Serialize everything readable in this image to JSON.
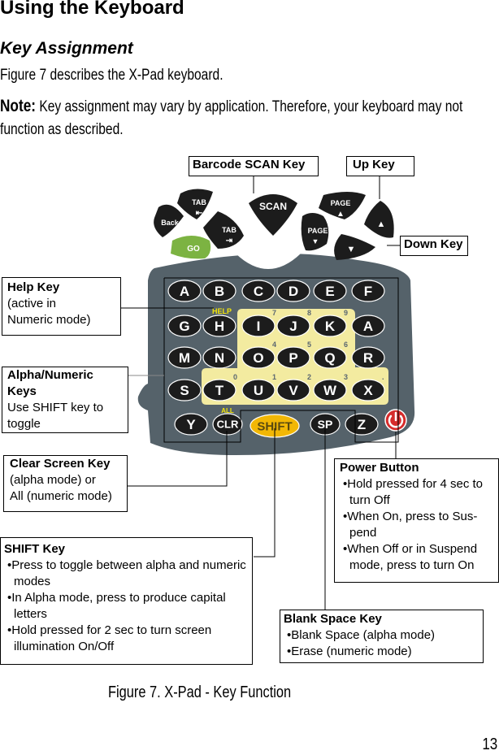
{
  "page": {
    "heading": "Using the Keyboard",
    "subheading": "Key Assignment",
    "intro": "Figure 7 describes the X-Pad keyboard.",
    "note_label": "Note:",
    "note_text": " Key assignment may vary by application. Therefore, your keyboard may not function as described.",
    "caption": "Figure 7.  X-Pad - Key Function",
    "page_number": "13"
  },
  "callouts": {
    "scan": {
      "title": "Barcode SCAN Key"
    },
    "up": {
      "title": "Up Key"
    },
    "down": {
      "title": "Down Key"
    },
    "help": {
      "title": "Help Key",
      "lines": [
        "(active in",
        "Numeric mode)"
      ]
    },
    "alpha": {
      "title": "Alpha/Numeric Keys",
      "text": "Use SHIFT key to toggle"
    },
    "clear": {
      "title": "Clear Screen Key",
      "lines": [
        "(alpha mode) or",
        "All (numeric mode)"
      ]
    },
    "shift": {
      "title": "SHIFT Key",
      "bullets": [
        "Press to toggle between alpha and numeric modes",
        "In Alpha mode, press to produce capital letters",
        "Hold pressed for 2 sec to turn screen illumination On/Off"
      ]
    },
    "power": {
      "title": "Power Button",
      "bullets": [
        "Hold pressed for 4 sec to turn Off",
        "When On, press to  Sus-pend",
        "When Off or in Suspend mode, press to turn On"
      ]
    },
    "space": {
      "title": "Blank Space Key",
      "bullets": [
        "Blank Space (alpha mode)",
        "Erase (numeric mode)"
      ]
    }
  },
  "keypad": {
    "top_keys": {
      "tab_back": "TAB",
      "back": "Back",
      "tab_fwd": "TAB",
      "go": "GO",
      "scan": "SCAN",
      "page_up": "PAGE",
      "page_down": "PAGE"
    },
    "help_label": "HELP",
    "all_label": "ALL",
    "rows": [
      [
        "A",
        "B",
        "C",
        "D",
        "E",
        "F"
      ],
      [
        "G",
        "H",
        "I",
        "J",
        "K",
        "A"
      ],
      [
        "M",
        "N",
        "O",
        "P",
        "Q",
        "R"
      ],
      [
        "S",
        "T",
        "U",
        "V",
        "W",
        "X"
      ]
    ],
    "numeric_hints": {
      "I": "7",
      "J": "8",
      "K": "9",
      "O": "4",
      "P": "5",
      "Q": "6",
      "T": "0",
      "U": "1",
      "V": "2",
      "W": "3",
      "X": "."
    },
    "bottom_row": [
      "Y",
      "CLR",
      "SHIFT",
      "SP",
      "Z"
    ],
    "colors": {
      "body": "#55626a",
      "key": "#1c1c1c",
      "numeric_area": "#f3eba0",
      "go": "#7cb342",
      "shift": "#f2b705",
      "power": "#d62b2b",
      "help_text": "#f5e60a",
      "hint_text": "#5a6670"
    }
  }
}
